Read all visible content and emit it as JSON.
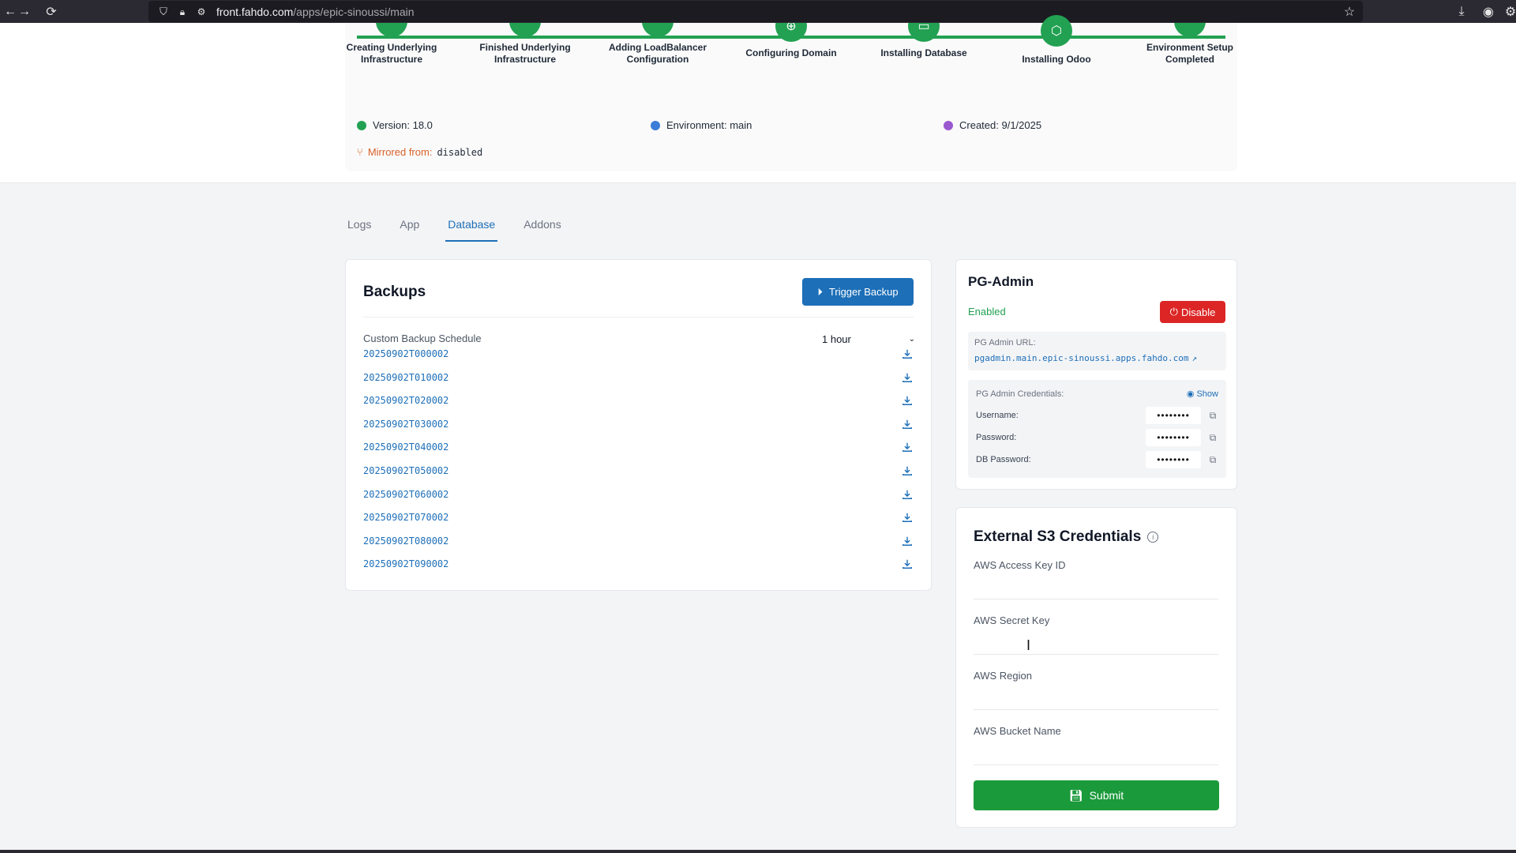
{
  "browser": {
    "url_domain": "front.fahdo.com",
    "url_path": "/apps/epic-sinoussi/main"
  },
  "steps": [
    {
      "label": "Creating Underlying Infrastructure"
    },
    {
      "label": "Finished Underlying Infrastructure"
    },
    {
      "label": "Adding LoadBalancer Configuration"
    },
    {
      "label": "Configuring Domain"
    },
    {
      "label": "Installing Database"
    },
    {
      "label": "Installing Odoo"
    },
    {
      "label": "Environment Setup Completed"
    }
  ],
  "meta": {
    "version": "Version: 18.0",
    "environment": "Environment: main",
    "created": "Created: 9/1/2025",
    "mirrored_label": "Mirrored from:",
    "mirrored_value": "disabled",
    "colors": {
      "version": "#22a152",
      "environment": "#3b7dd8",
      "created": "#9b59d0"
    }
  },
  "tabs": [
    {
      "label": "Logs"
    },
    {
      "label": "App"
    },
    {
      "label": "Database",
      "active": true
    },
    {
      "label": "Addons"
    }
  ],
  "backups": {
    "title": "Backups",
    "trigger_label": "Trigger Backup",
    "schedule_label": "Custom Backup Schedule",
    "schedule_value": "1 hour",
    "items": [
      "20250902T000002",
      "20250902T010002",
      "20250902T020002",
      "20250902T030002",
      "20250902T040002",
      "20250902T050002",
      "20250902T060002",
      "20250902T070002",
      "20250902T080002",
      "20250902T090002"
    ]
  },
  "pgadmin": {
    "title": "PG-Admin",
    "status": "Enabled",
    "disable_label": "Disable",
    "url_label": "PG Admin URL:",
    "url": "pgadmin.main.epic-sinoussi.apps.fahdo.com",
    "credentials_label": "PG Admin Credentials:",
    "show_label": "Show",
    "username_label": "Username:",
    "password_label": "Password:",
    "db_password_label": "DB Password:",
    "masked": "••••••••"
  },
  "s3": {
    "title": "External S3 Credentials",
    "access_key_label": "AWS Access Key ID",
    "secret_key_label": "AWS Secret Key",
    "region_label": "AWS Region",
    "bucket_label": "AWS Bucket Name",
    "submit_label": "Submit"
  },
  "colors": {
    "success": "#22a152",
    "primary": "#1d6fb8",
    "danger": "#dc2626",
    "submit": "#1b9a3b"
  }
}
